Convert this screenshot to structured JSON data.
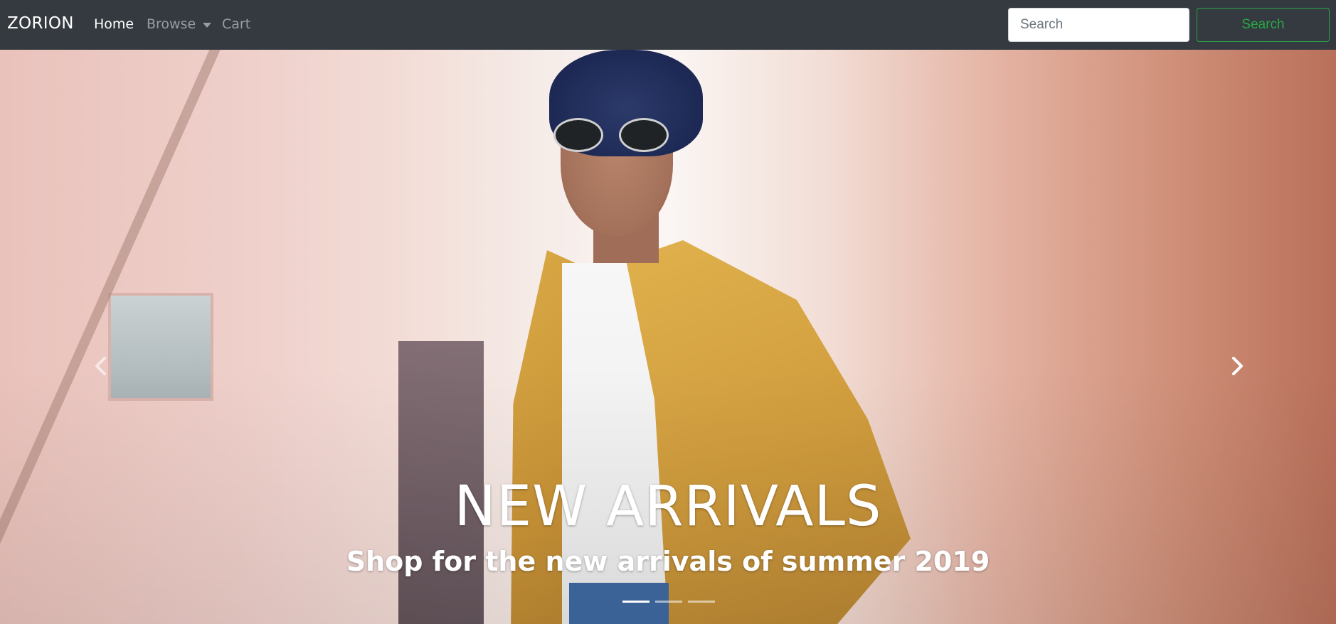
{
  "navbar": {
    "brand": "ZORION",
    "links": {
      "home": "Home",
      "browse": "Browse",
      "cart": "Cart"
    },
    "search": {
      "placeholder": "Search",
      "value": "",
      "button_label": "Search"
    }
  },
  "hero": {
    "title": "NEW ARRIVALS",
    "subtitle": "Shop for the new arrivals of summer 2019",
    "slide_count": 3,
    "active_slide": 1
  },
  "icons": {
    "prev": "chevron-left-icon",
    "next": "chevron-right-icon",
    "browse_caret": "caret-down-icon"
  },
  "colors": {
    "navbar_bg": "#343a40",
    "search_button_accent": "#28a745",
    "nav_active": "#ffffff",
    "nav_muted": "#9a9da0"
  }
}
